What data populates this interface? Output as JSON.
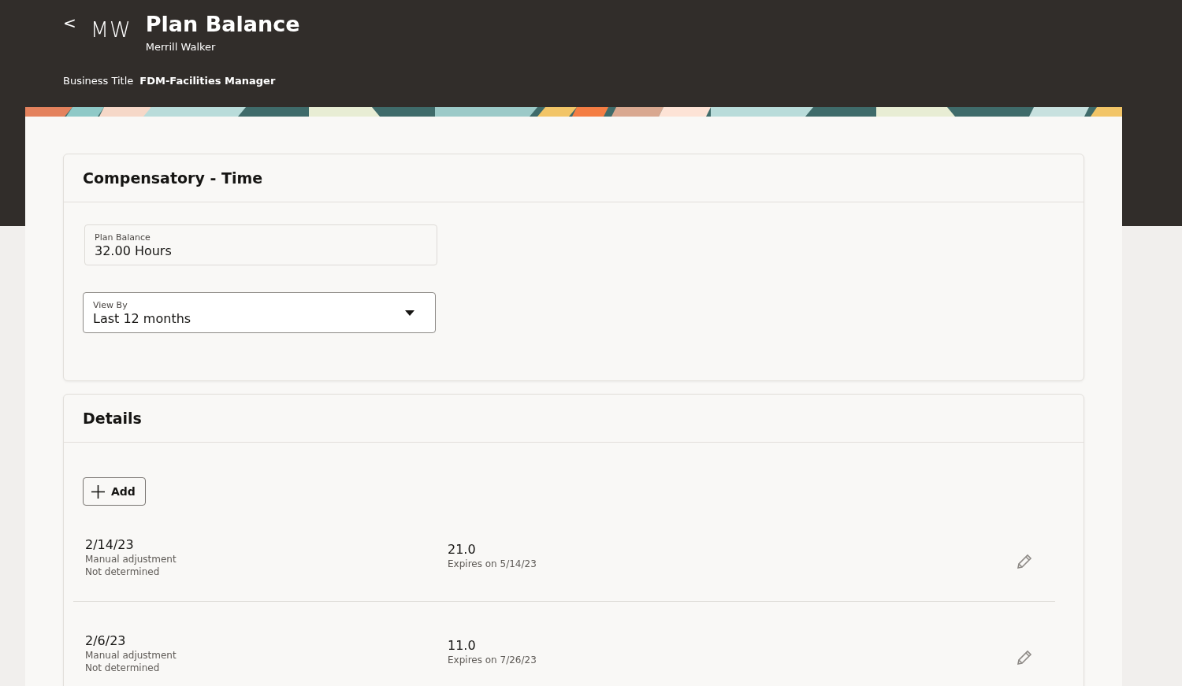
{
  "header": {
    "back_label": "<",
    "initials": "MW",
    "title": "Plan Balance",
    "subtitle": "Merrill Walker",
    "business_title_label": "Business Title",
    "business_title_value": "FDM-Facilities Manager"
  },
  "plan_section": {
    "title": "Compensatory - Time",
    "plan_balance": {
      "label": "Plan Balance",
      "value": "32.00 Hours"
    },
    "view_by": {
      "label": "View By",
      "value": "Last 12 months"
    }
  },
  "details_section": {
    "title": "Details",
    "add_button": "Add",
    "entries": [
      {
        "date": "2/14/23",
        "type": "Manual adjustment",
        "status": "Not determined",
        "amount": "21.0",
        "expiry": "Expires on 5/14/23"
      },
      {
        "date": "2/6/23",
        "type": "Manual adjustment",
        "status": "Not determined",
        "amount": "11.0",
        "expiry": "Expires on 7/26/23"
      }
    ]
  }
}
